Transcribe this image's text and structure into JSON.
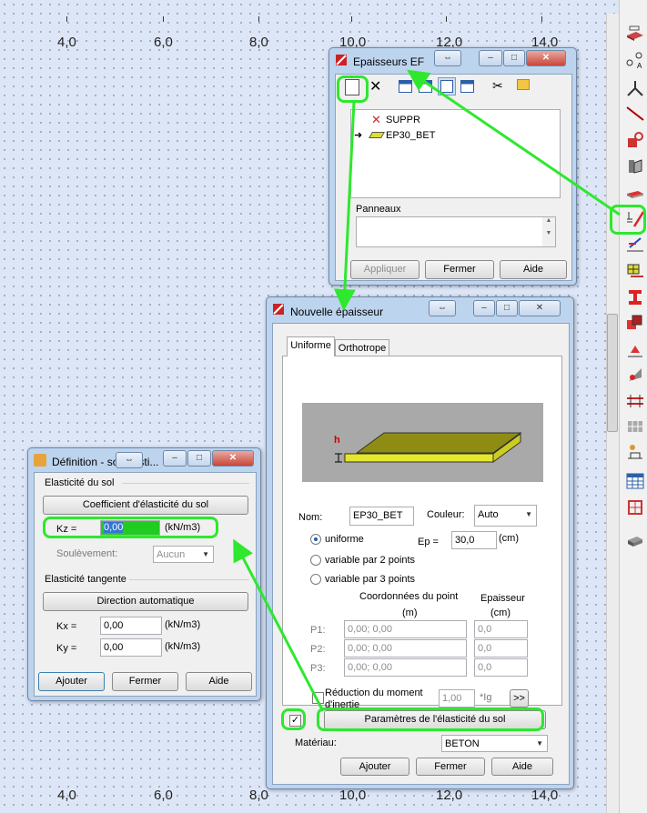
{
  "axis_top": [
    "4,0",
    "6,0",
    "8,0",
    "10,0",
    "12,0",
    "14,0"
  ],
  "axis_bottom": [
    "4,0",
    "6,0",
    "8,0",
    "10,0",
    "12,0",
    "14,0"
  ],
  "toolbar": {
    "icons": [
      "slab-icon",
      "node-icon",
      "member-icon",
      "line-icon",
      "support-icon",
      "release-icon",
      "panel-thickness-icon",
      "elastic-foundation-icon",
      "load-icon",
      "mesh-icon",
      "section-icon",
      "material-icon",
      "offset-icon",
      "hinge-icon",
      "bar-icon",
      "grid-icon",
      "table-icon",
      "structure-icon",
      "cube-icon"
    ]
  },
  "ep_ef": {
    "title": "Epaisseurs EF",
    "items": [
      {
        "label": "SUPPR"
      },
      {
        "label": "EP30_BET"
      }
    ],
    "panels_label": "Panneaux",
    "apply": "Appliquer",
    "close": "Fermer",
    "help": "Aide"
  },
  "nouv": {
    "title": "Nouvelle épaisseur",
    "tab_uniform": "Uniforme",
    "tab_ortho": "Orthotrope",
    "h_label": "h",
    "name_label": "Nom:",
    "name_value": "EP30_BET",
    "color_label": "Couleur:",
    "color_value": "Auto",
    "uniform": "uniforme",
    "ep_label": "Ep =",
    "ep_value": "30,0",
    "ep_unit": "(cm)",
    "var2": "variable par 2 points",
    "var3": "variable par 3 points",
    "coord_header": "Coordonnées du point",
    "coord_unit": "(m)",
    "ep_header": "Epaisseur",
    "ep_header_unit": "(cm)",
    "points": [
      {
        "label": "P1:",
        "coord": "0,00; 0,00",
        "ep": "0,0"
      },
      {
        "label": "P2:",
        "coord": "0,00; 0,00",
        "ep": "0,0"
      },
      {
        "label": "P3:",
        "coord": "0,00; 0,00",
        "ep": "0,0"
      }
    ],
    "reduction": "Réduction du moment",
    "reduction2": "d'inertie",
    "red_value": "1,00",
    "red_unit": "*Ig",
    "more": ">>",
    "soil_button": "Paramètres de l'élasticité du sol",
    "material_label": "Matériau:",
    "material_value": "BETON",
    "add": "Ajouter",
    "close": "Fermer",
    "help": "Aide"
  },
  "soil": {
    "title": "Définition - sol élasti...",
    "group1": "Elasticité du sol",
    "coef_button": "Coefficient d'élasticité du sol",
    "kz_label": "Kz =",
    "kz_value": "0,00",
    "kz_unit": "(kN/m3)",
    "uplift_label": "Soulèvement:",
    "uplift_value": "Aucun",
    "group2": "Elasticité tangente",
    "dir_button": "Direction automatique",
    "kx_label": "Kx =",
    "kx_value": "0,00",
    "kx_unit": "(kN/m3)",
    "ky_label": "Ky =",
    "ky_value": "0,00",
    "ky_unit": "(kN/m3)",
    "add": "Ajouter",
    "close": "Fermer",
    "help": "Aide"
  },
  "highlight_color": "#2ee82e"
}
